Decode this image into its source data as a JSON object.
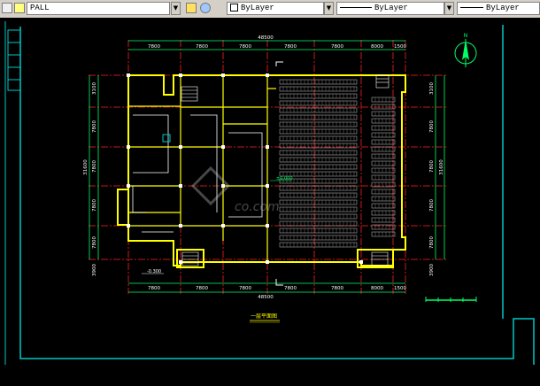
{
  "toolbar": {
    "layer_name": "PALL",
    "color_value": "ByLayer",
    "linetype_value": "ByLayer",
    "lineweight_value": "ByLayer",
    "dropdown_glyph": "▼"
  },
  "drawing": {
    "top_total_dim": "48500",
    "top_dims": [
      "7800",
      "7800",
      "7800",
      "7800",
      "7800",
      "8000",
      "1500"
    ],
    "bottom_total_dim": "48500",
    "bottom_dims": [
      "7800",
      "7800",
      "7800",
      "7800",
      "7800",
      "8000",
      "1500"
    ],
    "left_total_dim": "31600",
    "left_dims": [
      "3100",
      "7800",
      "7800",
      "7800",
      "7800",
      "3900"
    ],
    "right_total_dim": "31600",
    "right_dims": [
      "3100",
      "7800",
      "7800",
      "7800",
      "7800",
      "3900"
    ],
    "level_mark_1": "±0.000",
    "level_mark_2": "-0.300",
    "plan_title": "一层平面图",
    "watermark_text": "co.com",
    "north_label": "N"
  },
  "colors": {
    "wall": "#ffff00",
    "axis": "#ff2020",
    "dimension": "#00ff66",
    "text": "#ffffff",
    "border": "#00c8c8",
    "seat": "#c8c8c8"
  }
}
